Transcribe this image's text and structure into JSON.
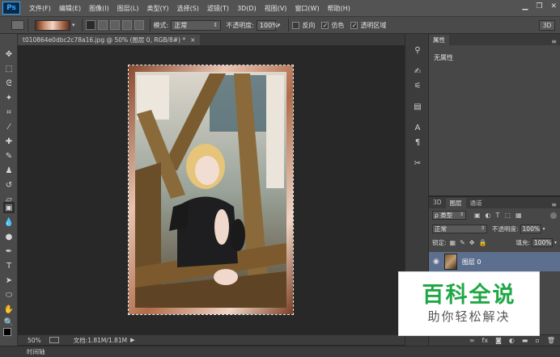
{
  "app": {
    "logo": "Ps"
  },
  "menubar": {
    "items": [
      "文件(F)",
      "编辑(E)",
      "图像(I)",
      "图层(L)",
      "类型(Y)",
      "选择(S)",
      "滤镜(T)",
      "3D(D)",
      "视图(V)",
      "窗口(W)",
      "帮助(H)"
    ],
    "window_controls": [
      "minimize-icon",
      "restore-icon",
      "close-icon"
    ]
  },
  "options": {
    "mode_label": "模式:",
    "mode_value": "正常",
    "opacity_label": "不透明度:",
    "opacity_value": "100%",
    "reverse_label": "反向",
    "dither_label": "仿色",
    "transparency_label": "透明区域",
    "dither_checked": true,
    "transparency_checked": true,
    "reverse_checked": false,
    "threed_label": "3D"
  },
  "document": {
    "tab_title": "t010864e0dbc2c78a16.jpg @ 50% (图层 0, RGB/8#) *",
    "tab_close": "×"
  },
  "status": {
    "zoom": "50%",
    "doc_size": "文档:1.81M/1.81M",
    "timeline_label": "时间轴"
  },
  "properties": {
    "tab": "属性",
    "content": "无属性"
  },
  "layers": {
    "tabs": [
      "3D",
      "图层",
      "通道"
    ],
    "active_tab": "图层",
    "filter_type": "ρ 类型",
    "blend_mode": "正常",
    "opacity_label": "不透明度:",
    "opacity_value": "100%",
    "lock_label": "锁定:",
    "fill_label": "填充:",
    "fill_value": "100%",
    "rows": [
      {
        "name": "图层 0"
      }
    ]
  },
  "watermark": {
    "title": "百科全说",
    "subtitle": "助你轻松解决"
  },
  "colors": {
    "accent": "#31a8ff",
    "layer_selected": "#5d6f8e",
    "watermark_green": "#20a745"
  }
}
